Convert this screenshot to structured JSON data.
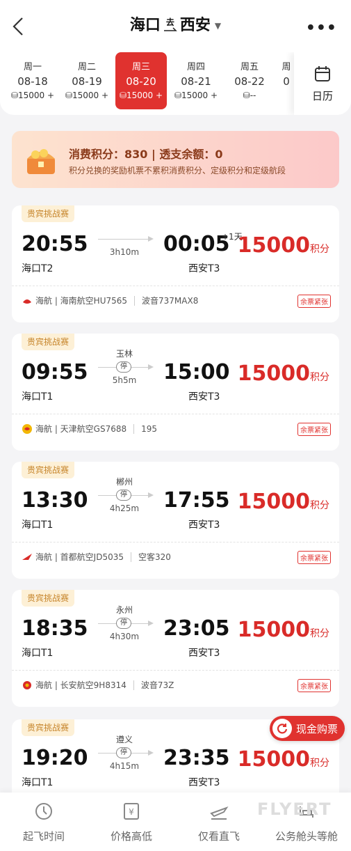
{
  "header": {
    "from": "海口",
    "to": "西安",
    "direction": "去",
    "dropdown": "▼",
    "more": "•••"
  },
  "dates": [
    {
      "week": "周一",
      "date": "08-18",
      "price": "15000 +"
    },
    {
      "week": "周二",
      "date": "08-19",
      "price": "15000 +"
    },
    {
      "week": "周三",
      "date": "08-20",
      "price": "15000 +"
    },
    {
      "week": "周四",
      "date": "08-21",
      "price": "15000 +"
    },
    {
      "week": "周五",
      "date": "08-22",
      "price": "--"
    },
    {
      "week": "周",
      "date": "0",
      "price": ""
    }
  ],
  "calendar_label": "日历",
  "points": {
    "title": "消费积分：830 | 透支余额：0",
    "note": "积分兑换的奖励机票不累积消费积分、定级积分和定级航段"
  },
  "flights": [
    {
      "tag": "贵宾挑战赛",
      "dep": "20:55",
      "arr": "00:05",
      "plus": "+1天",
      "dep_ap": "海口T2",
      "arr_ap": "西安T3",
      "stop": "",
      "ting": "",
      "dur": "3h10m",
      "price": "15000",
      "unit": "积分",
      "airline": "海航 | 海南航空HU7565",
      "plane": "波音737MAX8",
      "badge": "余票紧张"
    },
    {
      "tag": "贵宾挑战赛",
      "dep": "09:55",
      "arr": "15:00",
      "plus": "",
      "dep_ap": "海口T1",
      "arr_ap": "西安T3",
      "stop": "玉林",
      "ting": "停",
      "dur": "5h5m",
      "price": "15000",
      "unit": "积分",
      "airline": "海航 | 天津航空GS7688",
      "plane": "195",
      "badge": "余票紧张"
    },
    {
      "tag": "贵宾挑战赛",
      "dep": "13:30",
      "arr": "17:55",
      "plus": "",
      "dep_ap": "海口T1",
      "arr_ap": "西安T3",
      "stop": "郴州",
      "ting": "停",
      "dur": "4h25m",
      "price": "15000",
      "unit": "积分",
      "airline": "海航 | 首都航空JD5035",
      "plane": "空客320",
      "badge": "余票紧张"
    },
    {
      "tag": "贵宾挑战赛",
      "dep": "18:35",
      "arr": "23:05",
      "plus": "",
      "dep_ap": "海口T1",
      "arr_ap": "西安T3",
      "stop": "永州",
      "ting": "停",
      "dur": "4h30m",
      "price": "15000",
      "unit": "积分",
      "airline": "海航 | 长安航空9H8314",
      "plane": "波音73Z",
      "badge": "余票紧张"
    },
    {
      "tag": "贵宾挑战赛",
      "dep": "19:20",
      "arr": "23:35",
      "plus": "",
      "dep_ap": "海口T1",
      "arr_ap": "西安T3",
      "stop": "遵义",
      "ting": "停",
      "dur": "4h15m",
      "price": "15000",
      "unit": "积分",
      "airline": "",
      "plane": "",
      "badge": ""
    }
  ],
  "cash_button": "现金购票",
  "bottom": [
    {
      "label": "起飞时间"
    },
    {
      "label": "价格高低"
    },
    {
      "label": "仅看直飞"
    },
    {
      "label": "公务舱头等舱"
    }
  ],
  "watermark": "FLYERT",
  "colors": {
    "accent": "#e0322f",
    "tag_bg": "#fdf0d6"
  }
}
